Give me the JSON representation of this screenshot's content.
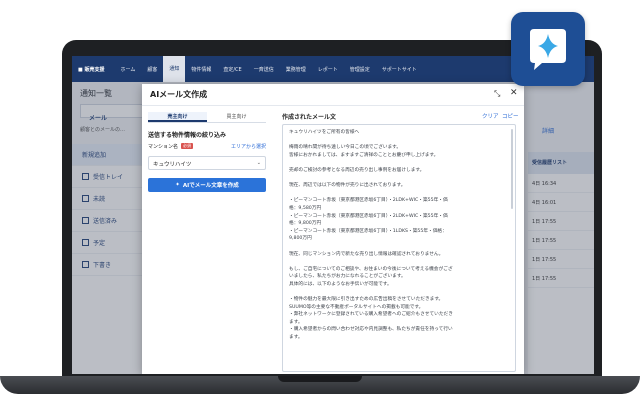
{
  "nav": {
    "brand": "■ 販売支援",
    "items": [
      "ホーム",
      "顧客",
      "通知",
      "物件情報",
      "査定/CE",
      "一斉送信",
      "業務管理",
      "レポート",
      "管理設定",
      "サポートサイト"
    ],
    "active_index": 2
  },
  "background": {
    "title": "通知一覧",
    "tab": "メール",
    "note": "顧客とのメールの…",
    "sidebar": [
      "新規追加",
      "受信トレイ",
      "未読",
      "送信済み",
      "予定",
      "下書き"
    ],
    "right_header": "受信履歴リスト",
    "right_rows": [
      "4日 16:34",
      "4日 16:01",
      "1日 17:55",
      "1日 17:55",
      "1日 17:55",
      "1日 17:55"
    ],
    "edit_link": "詳細"
  },
  "modal": {
    "title": "AIメール文作成",
    "pin_icon": "pin-icon",
    "close_icon": "close-icon",
    "tabs": [
      "売主向け",
      "買主向け"
    ],
    "active_tab": 0,
    "section_title": "送信する物件情報の絞り込み",
    "mansion_label": "マンション名",
    "required_badge": "必須",
    "area_link": "エリアから選択",
    "mansion_value": "キュウリハイツ",
    "generate_button": "AIでメール文章を作成",
    "generated_label": "作成されたメール文",
    "clear_link": "クリア",
    "copy_link": "コピー",
    "mail_lines": [
      "キュウリハイツをご所有の皆様へ",
      "",
      "梅雨の晴れ間が待ち遠しい今日この頃でございます。",
      "皆様におかれましては、ますますご清祥のこととお慶び申し上げます。",
      "",
      "売却のご検討の参考となる周辺の売り出し事例をお届けします。",
      "",
      "現在、周辺では以下の物件が売りに出されております。",
      "",
      "・ピーマンコート赤坂（東京都港区赤坂6丁目）・2LDK+WIC・築55年・価",
      "格：9,580万円",
      "・ピーマンコート赤坂（東京都港区赤坂6丁目）・2LDK+WIC・築55年・価",
      "格：9,800万円",
      "・ピーマンコート赤坂（東京都港区赤坂6丁目）・1LDKS・築55年・価格：",
      "9,800万円",
      "",
      "現在、同じマンション内で新たな売り出し情報は確認されておりません。",
      "",
      "もし、ご自宅についてのご相談や、お住まいの今後について考える機会がござ",
      "いましたら、私たちがお力になれることがございます。",
      "具体的には、以下のようなお手伝いが可能です。",
      "",
      "・物件の魅力を最大限に引き出すための広告出稿をさせていただきます。",
      "SUUMO等の主要な不動産ポータルサイトへの掲載も可能です。",
      "・弊社ネットワークに登録されている購入希望者へのご紹介もさせていただき",
      "ます。",
      "・購入希望者からの問い合わせ対応や内見調整も、私たちが責任を持って行い",
      "ます。"
    ]
  },
  "app_icon": "ai-sparkle-icon",
  "colors": {
    "nav": "#1d3a6e",
    "accent": "#2b73d9",
    "icon_bg": "#1e4e95",
    "icon_star": "#3aa8e6"
  }
}
